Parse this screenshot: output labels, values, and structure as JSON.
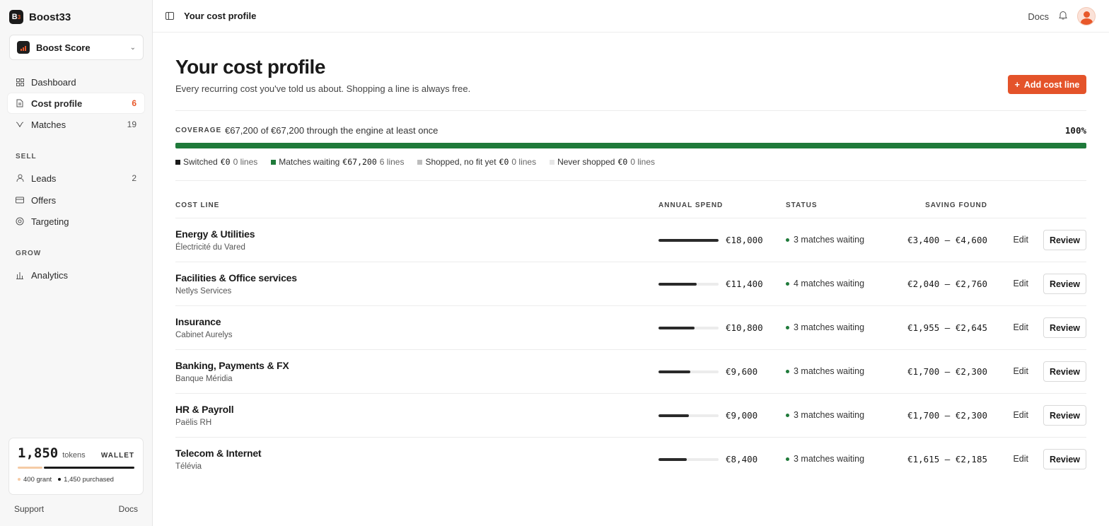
{
  "brand": {
    "name": "Boost33",
    "logo_text": "B"
  },
  "workspace": {
    "name": "Boost Score"
  },
  "nav": {
    "main": [
      {
        "label": "Dashboard",
        "icon": "grid-icon",
        "count": ""
      },
      {
        "label": "Cost profile",
        "icon": "document-icon",
        "count": "6"
      },
      {
        "label": "Matches",
        "icon": "match-icon",
        "count": "19"
      }
    ],
    "sell_label": "SELL",
    "sell": [
      {
        "label": "Leads",
        "icon": "user-icon",
        "count": "2"
      },
      {
        "label": "Offers",
        "icon": "card-icon",
        "count": ""
      },
      {
        "label": "Targeting",
        "icon": "target-icon",
        "count": ""
      }
    ],
    "grow_label": "GROW",
    "grow": [
      {
        "label": "Analytics",
        "icon": "bar-chart-icon",
        "count": ""
      }
    ]
  },
  "wallet": {
    "amount": "1,850",
    "unit": "tokens",
    "tag": "WALLET",
    "grant_label": "400 grant",
    "purchased_label": "1,450 purchased"
  },
  "footer": {
    "support": "Support",
    "docs": "Docs"
  },
  "topbar": {
    "breadcrumb": "Your cost profile",
    "docs": "Docs"
  },
  "page": {
    "title": "Your cost profile",
    "subtitle": "Every recurring cost you've told us about. Shopping a line is always free.",
    "add_button": "Add cost line"
  },
  "coverage": {
    "label": "COVERAGE",
    "text": "€67,200 of €67,200 through the engine at least once",
    "percent": "100%",
    "fraction": 1.0,
    "legend": [
      {
        "label": "Switched",
        "amount": "€0",
        "lines": "0 lines",
        "color": "#1a1a1a"
      },
      {
        "label": "Matches waiting",
        "amount": "€67,200",
        "lines": "6 lines",
        "color": "#1f7a3a"
      },
      {
        "label": "Shopped, no fit yet",
        "amount": "€0",
        "lines": "0 lines",
        "color": "#bdbdbd"
      },
      {
        "label": "Never shopped",
        "amount": "€0",
        "lines": "0 lines",
        "color": "#e6e6e6"
      }
    ]
  },
  "table": {
    "headers": {
      "cost_line": "COST LINE",
      "annual_spend": "ANNUAL SPEND",
      "status": "STATUS",
      "saving": "SAVING FOUND"
    },
    "edit_label": "Edit",
    "review_label": "Review",
    "rows": [
      {
        "name": "Energy & Utilities",
        "vendor": "Électricité du Vared",
        "spend": "€18,000",
        "spend_fraction": 1.0,
        "status": "3 matches waiting",
        "saving": "€3,400 – €4,600"
      },
      {
        "name": "Facilities & Office services",
        "vendor": "Netlys Services",
        "spend": "€11,400",
        "spend_fraction": 0.633,
        "status": "4 matches waiting",
        "saving": "€2,040 – €2,760"
      },
      {
        "name": "Insurance",
        "vendor": "Cabinet Aurelys",
        "spend": "€10,800",
        "spend_fraction": 0.6,
        "status": "3 matches waiting",
        "saving": "€1,955 – €2,645"
      },
      {
        "name": "Banking, Payments & FX",
        "vendor": "Banque Méridia",
        "spend": "€9,600",
        "spend_fraction": 0.533,
        "status": "3 matches waiting",
        "saving": "€1,700 – €2,300"
      },
      {
        "name": "HR & Payroll",
        "vendor": "Paëlis RH",
        "spend": "€9,000",
        "spend_fraction": 0.5,
        "status": "3 matches waiting",
        "saving": "€1,700 – €2,300"
      },
      {
        "name": "Telecom & Internet",
        "vendor": "Télévia",
        "spend": "€8,400",
        "spend_fraction": 0.467,
        "status": "3 matches waiting",
        "saving": "€1,615 – €2,185"
      }
    ]
  },
  "colors": {
    "accent": "#e4532a",
    "positive": "#1f7a3a"
  }
}
